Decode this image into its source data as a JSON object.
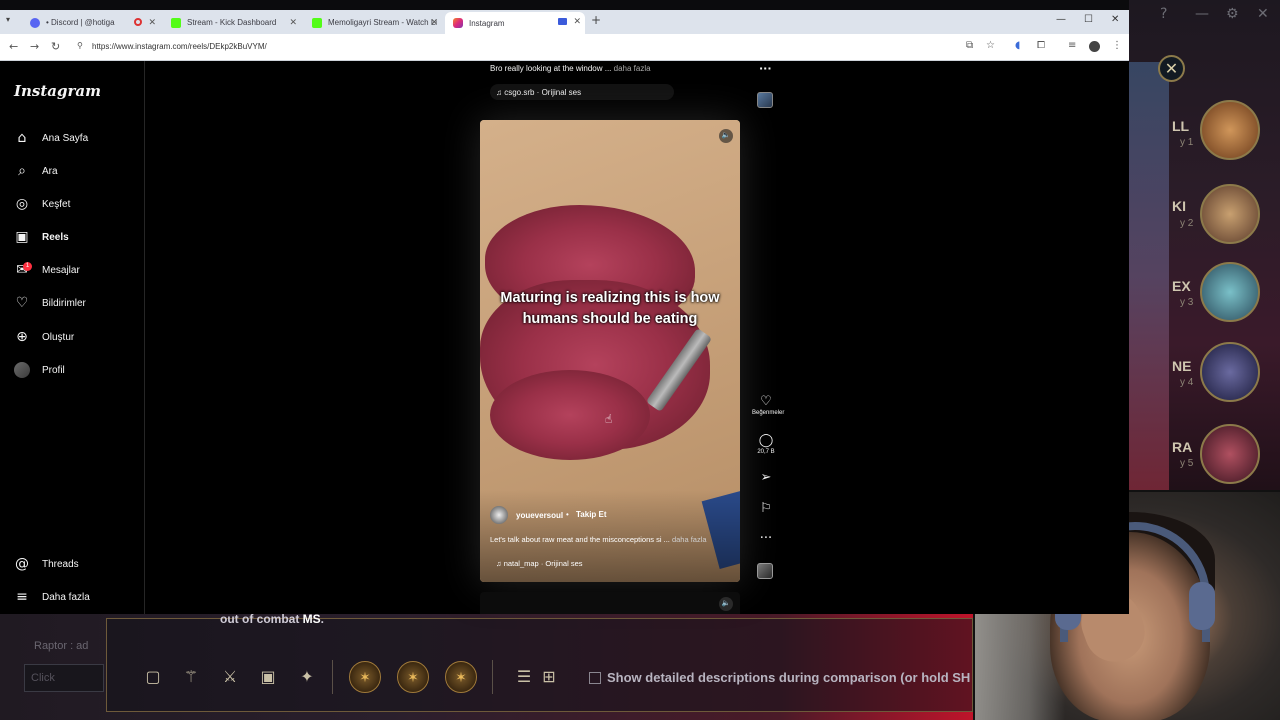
{
  "browser": {
    "tabs": [
      {
        "title": "• Discord | @hotiga",
        "color": "#5865f2"
      },
      {
        "title": "Stream - Kick Dashboard",
        "color": "#53fc18"
      },
      {
        "title": "Memoligayri Stream - Watch Li",
        "color": "#53fc18"
      },
      {
        "title": "Instagram",
        "color": "#e1306c"
      }
    ],
    "new_tab_icon": "+",
    "url": "https://www.instagram.com/reels/DEkp2kBuVYM/"
  },
  "instagram": {
    "logo": "Instagram",
    "nav": [
      {
        "label": "Ana Sayfa",
        "icon": "⌂"
      },
      {
        "label": "Ara",
        "icon": "⌕"
      },
      {
        "label": "Keşfet",
        "icon": "◎"
      },
      {
        "label": "Reels",
        "icon": "▣"
      },
      {
        "label": "Mesajlar",
        "icon": "✉"
      },
      {
        "label": "Bildirimler",
        "icon": "♡"
      },
      {
        "label": "Oluştur",
        "icon": "⊕"
      },
      {
        "label": "Profil",
        "icon": ""
      }
    ],
    "messages_badge": "1",
    "bottom_nav": [
      {
        "label": "Threads",
        "icon": "@"
      },
      {
        "label": "Daha fazla",
        "icon": "≡"
      }
    ],
    "prev_reel": {
      "caption": "Bro really looking at the window ...",
      "more": "daha fazla",
      "audio": "♫ csgo.srb · Orijinal ses"
    },
    "reel": {
      "overlay_text": "Maturing is realizing this is how humans  should be eating",
      "username": "youeversoul",
      "dot": "•",
      "follow": "Takip Et",
      "caption": "Let's talk about raw meat and the misconceptions si ...",
      "more": "daha fazla",
      "audio": "♫ natal_map · Orijinal ses"
    },
    "actions": {
      "like_label": "Beğenmeler",
      "comment_count": "20,7 B"
    }
  },
  "game": {
    "hint_prefix": "out of combat ",
    "hint_bold": "MS",
    "side_text": "Raptor : ad",
    "chat_placeholder": "Click",
    "checkbox_label": "Show detailed descriptions during comparison (or hold SH",
    "champs": [
      {
        "label": "LL",
        "sub": "y 1"
      },
      {
        "label": "KI",
        "sub": "y 2"
      },
      {
        "label": "EX",
        "sub": "y 3"
      },
      {
        "label": "NE",
        "sub": "y 4"
      },
      {
        "label": "RA",
        "sub": "y 5"
      }
    ]
  }
}
